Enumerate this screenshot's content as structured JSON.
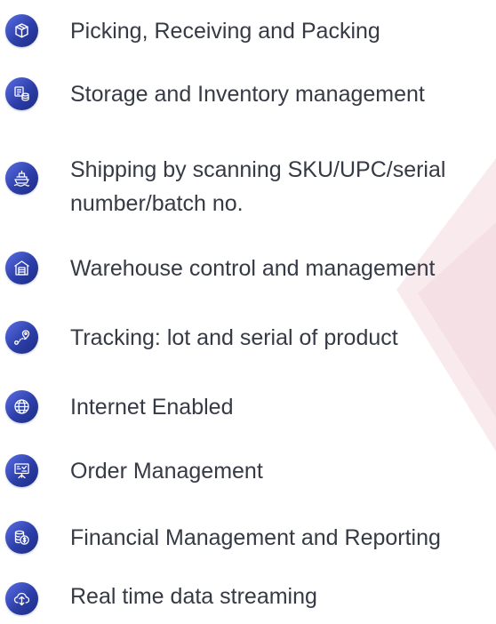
{
  "features": [
    {
      "label": "Picking, Receiving and Packing",
      "icon": "package-box-icon"
    },
    {
      "label": "Storage and Inventory management",
      "icon": "inventory-database-icon"
    },
    {
      "label": "Shipping by scanning SKU/UPC/serial number/batch no.",
      "icon": "ship-icon"
    },
    {
      "label": "Warehouse control and management",
      "icon": "warehouse-icon"
    },
    {
      "label": "Tracking: lot and serial of product",
      "icon": "route-tracking-icon"
    },
    {
      "label": "Internet Enabled",
      "icon": "globe-icon"
    },
    {
      "label": "Order Management",
      "icon": "presentation-board-icon"
    },
    {
      "label": "Financial Management and Reporting",
      "icon": "finance-coins-icon"
    },
    {
      "label": "Real time data streaming",
      "icon": "cloud-streaming-icon"
    }
  ],
  "colors": {
    "icon_gradient_start": "#5a6fe6",
    "icon_gradient_end": "#1d2c84",
    "text": "#363a45",
    "background_accent": "#f8e7ea"
  }
}
